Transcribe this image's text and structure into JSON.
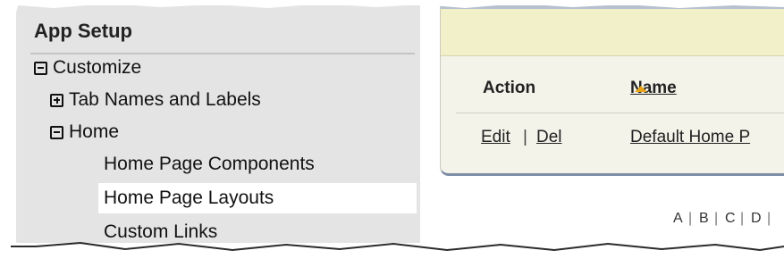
{
  "sidebar": {
    "title": "App Setup",
    "items": [
      {
        "label": "Customize",
        "toggle": "minus",
        "level": 0
      },
      {
        "label": "Tab Names and Labels",
        "toggle": "plus",
        "level": 1
      },
      {
        "label": "Home",
        "toggle": "minus",
        "level": 1
      },
      {
        "label": "Home Page Components",
        "toggle": "none",
        "level": 2
      },
      {
        "label": "Home Page Layouts",
        "toggle": "none",
        "level": 2,
        "selected": true
      },
      {
        "label": "Custom Links",
        "toggle": "none",
        "level": 2
      }
    ]
  },
  "table": {
    "columns": [
      "Action",
      "Name"
    ],
    "sort_indicator": "ascending-arrow-icon",
    "row": {
      "edit_label": "Edit",
      "separator": "|",
      "delete_label": "Del",
      "name": "Default Home P"
    }
  },
  "alpha_filter": {
    "letters": [
      "A",
      "B",
      "C",
      "D"
    ],
    "separator": "|"
  },
  "colors": {
    "sidebar_bg": "#e4e4e4",
    "panel_header_bg": "#f1f0c8",
    "sort_arrow": "#e8a317",
    "panel_border": "#7d8da6"
  }
}
